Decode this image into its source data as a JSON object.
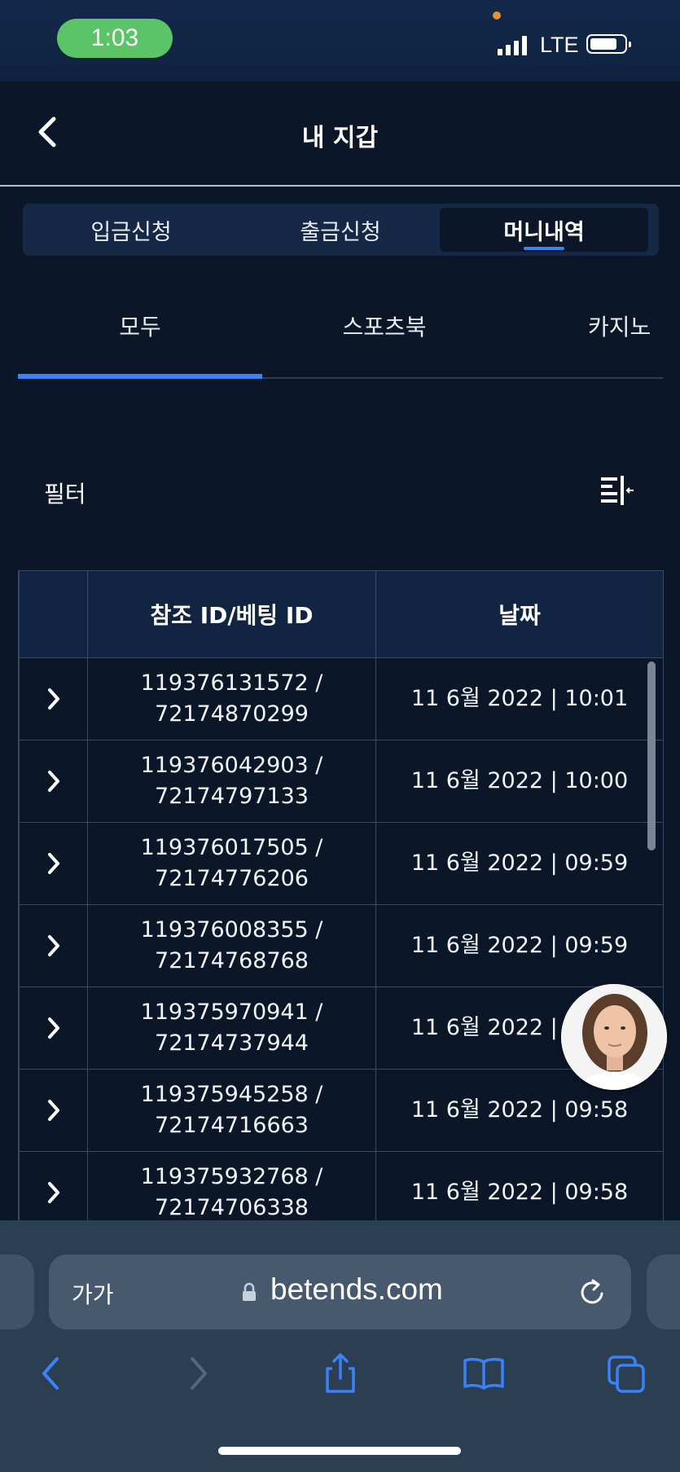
{
  "status": {
    "time": "1:03",
    "network": "LTE"
  },
  "header": {
    "title": "내 지갑"
  },
  "top_tabs": [
    {
      "label": "입금신청",
      "active": false
    },
    {
      "label": "출금신청",
      "active": false
    },
    {
      "label": "머니내역",
      "active": true
    }
  ],
  "sub_tabs": [
    {
      "label": "모두",
      "active": true
    },
    {
      "label": "스포츠북",
      "active": false
    },
    {
      "label": "카지노",
      "active": false
    }
  ],
  "filter": {
    "label": "필터"
  },
  "table": {
    "columns": [
      "",
      "참조 ID/베팅 ID",
      "날짜"
    ],
    "rows": [
      {
        "ref": "119376131572 /",
        "bet": "72174870299",
        "date": "11 6월 2022 | 10:01"
      },
      {
        "ref": "119376042903 /",
        "bet": "72174797133",
        "date": "11 6월 2022 | 10:00"
      },
      {
        "ref": "119376017505 /",
        "bet": "72174776206",
        "date": "11 6월 2022 | 09:59"
      },
      {
        "ref": "119376008355 /",
        "bet": "72174768768",
        "date": "11 6월 2022 | 09:59"
      },
      {
        "ref": "119375970941 /",
        "bet": "72174737944",
        "date": "11 6월 2022 | 09:58"
      },
      {
        "ref": "119375945258 /",
        "bet": "72174716663",
        "date": "11 6월 2022 | 09:58"
      },
      {
        "ref": "119375932768 /",
        "bet": "72174706338",
        "date": "11 6월 2022 | 09:58"
      }
    ]
  },
  "browser": {
    "text_size_label": "가가",
    "url": "betends.com"
  },
  "colors": {
    "accent": "#3b82f6",
    "background": "#0b1628",
    "header_row": "#112442",
    "time_pill": "#5bc466"
  }
}
